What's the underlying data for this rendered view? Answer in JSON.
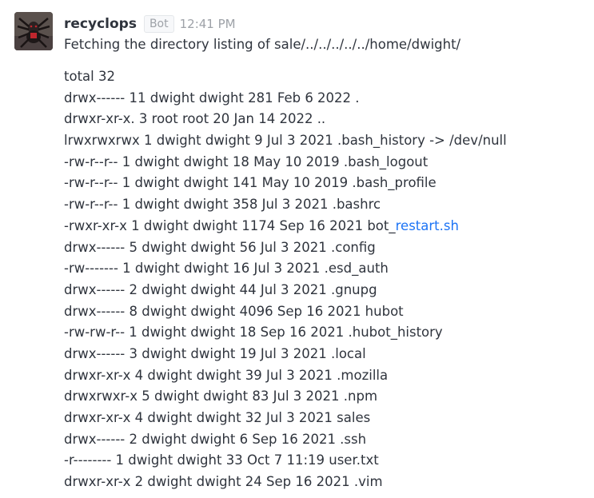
{
  "message": {
    "avatar_icon": "user-avatar-spider-icon",
    "username": "recyclops",
    "badge": "Bot",
    "timestamp": "12:41 PM",
    "intro": "Fetching the directory listing of sale/../../../../../home/dwight/",
    "link_color": "#1d74f5",
    "lines": [
      "total 32",
      "drwx------ 11 dwight dwight 281 Feb 6 2022 .",
      "drwxr-xr-x. 3 root root 20 Jan 14 2022 ..",
      "lrwxrwxrwx 1 dwight dwight 9 Jul 3 2021 .bash_history -> /dev/null",
      "-rw-r--r-- 1 dwight dwight 18 May 10 2019 .bash_logout",
      "-rw-r--r-- 1 dwight dwight 141 May 10 2019 .bash_profile",
      "-rw-r--r-- 1 dwight dwight 358 Jul 3 2021 .bashrc",
      {
        "prefix": "-rwxr-xr-x 1 dwight dwight 1174 Sep 16 2021 bot_",
        "link": "restart.sh"
      },
      "drwx------ 5 dwight dwight 56 Jul 3 2021 .config",
      "-rw------- 1 dwight dwight 16 Jul 3 2021 .esd_auth",
      "drwx------ 2 dwight dwight 44 Jul 3 2021 .gnupg",
      "drwx------ 8 dwight dwight 4096 Sep 16 2021 hubot",
      "-rw-rw-r-- 1 dwight dwight 18 Sep 16 2021 .hubot_history",
      "drwx------ 3 dwight dwight 19 Jul 3 2021 .local",
      "drwxr-xr-x 4 dwight dwight 39 Jul 3 2021 .mozilla",
      "drwxrwxr-x 5 dwight dwight 83 Jul 3 2021 .npm",
      "drwxr-xr-x 4 dwight dwight 32 Jul 3 2021 sales",
      "drwx------ 2 dwight dwight 6 Sep 16 2021 .ssh",
      "-r-------- 1 dwight dwight 33 Oct 7 11:19 user.txt",
      "drwxr-xr-x 2 dwight dwight 24 Sep 16 2021 .vim"
    ]
  }
}
